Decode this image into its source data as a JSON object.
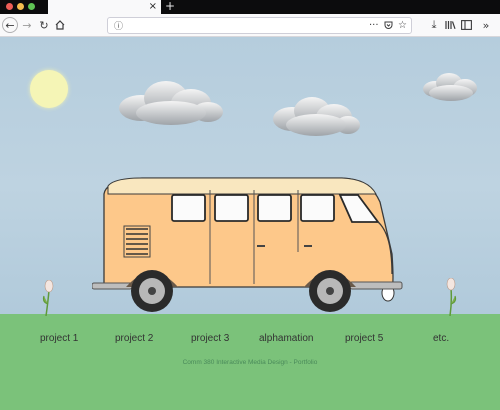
{
  "browser": {
    "window_controls": [
      "#ee5e57",
      "#f4bd4f",
      "#5fc454"
    ],
    "tab_close": "×",
    "new_tab": "+",
    "url": ""
  },
  "nav": {
    "items": [
      "project 1",
      "project 2",
      "project 3",
      "alphamation",
      "project 5",
      "etc."
    ]
  },
  "footer": "Comm 380 Interactive Media Design - Portfolio",
  "colors": {
    "sky": "#b5cddd",
    "grass": "#7bc27a",
    "van_body": "#fdc88a",
    "sun": "#f5f5b6"
  }
}
